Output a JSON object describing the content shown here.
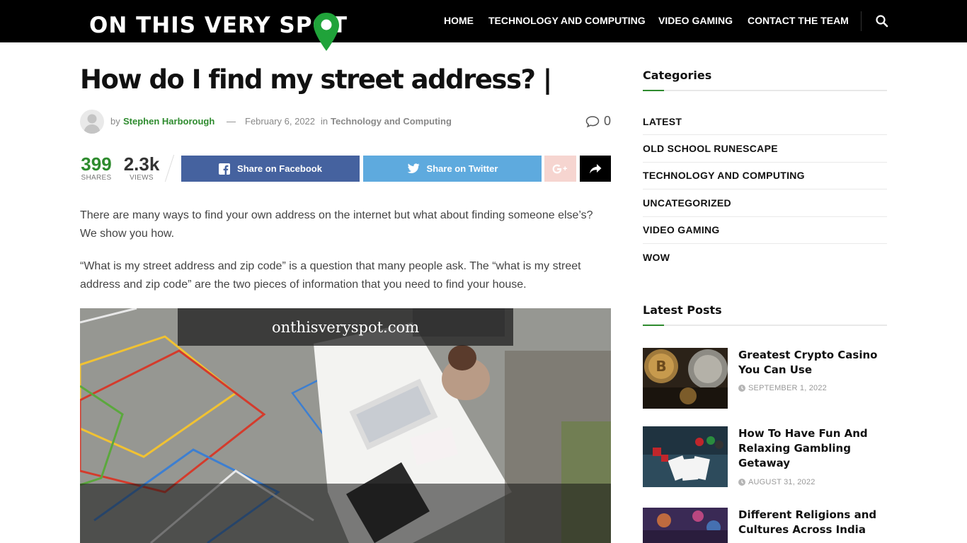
{
  "header": {
    "logo_text": "ON THIS VERY SPOT",
    "nav": [
      "HOME",
      "TECHNOLOGY AND COMPUTING",
      "VIDEO GAMING",
      "CONTACT THE TEAM"
    ],
    "icons": [
      "map-pin-icon",
      "search-icon"
    ]
  },
  "article": {
    "title": "How do I find my street address? |",
    "by": "by",
    "author": "Stephen Harborough",
    "dash": "—",
    "date": "February 6, 2022",
    "in": "in",
    "category": "Technology and Computing",
    "comments": "0",
    "shares_count": "399",
    "shares_label": "SHARES",
    "views_count": "2.3k",
    "views_label": "VIEWS",
    "share_facebook": "Share on Facebook",
    "share_twitter": "Share on Twitter",
    "para1": "There are many ways to find your own address on the internet but what about finding someone else’s? We show you how.",
    "para2": "“What is my street address and zip code” is a question that many people ask. The “what is my street address and zip code” are the two pieces of information that you need to find your house.",
    "image_banner": "onthisveryspot.com"
  },
  "sidebar": {
    "categories_heading": "Categories",
    "categories": [
      "LATEST",
      "OLD SCHOOL RUNESCAPE",
      "TECHNOLOGY AND COMPUTING",
      "UNCATEGORIZED",
      "VIDEO GAMING",
      "WOW"
    ],
    "latest_heading": "Latest Posts",
    "posts": [
      {
        "title": "Greatest Crypto Casino You Can Use",
        "date": "SEPTEMBER 1, 2022"
      },
      {
        "title": "How To Have Fun And Relaxing Gambling Getaway",
        "date": "AUGUST 31, 2022"
      },
      {
        "title": "Different Religions and Cultures Across India",
        "date": ""
      }
    ]
  },
  "colors": {
    "accent_green": "#2e8b2e",
    "facebook": "#45629f",
    "twitter": "#5eaade",
    "header_bg": "#000000"
  }
}
